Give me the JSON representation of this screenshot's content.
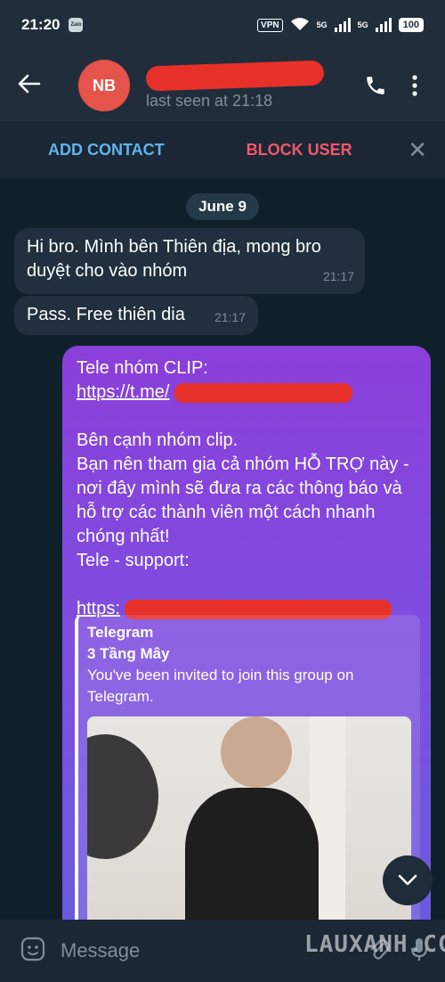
{
  "status": {
    "time": "21:20",
    "zalo": "Zalo",
    "vpn": "VPN",
    "net1": "5G",
    "net2": "5G",
    "battery": "100"
  },
  "header": {
    "avatar_initials": "NB",
    "avatar_color": "#e5534b",
    "subtitle": "last seen at 21:18",
    "back_icon": "arrow-left-icon",
    "call_icon": "phone-icon",
    "menu_icon": "more-vertical-icon"
  },
  "actions": {
    "add_contact": "ADD CONTACT",
    "block_user": "BLOCK USER",
    "close": "✕"
  },
  "chat": {
    "date_label": "June 9",
    "messages_in": [
      {
        "text": "Hi bro. Mình bên Thiên địa, mong bro duyệt cho vào nhóm",
        "time": "21:17"
      },
      {
        "text": "Pass. Free thiên dia",
        "time": "21:17"
      }
    ],
    "message_out": {
      "line1": "Tele nhóm CLIP:",
      "link1": "https://t.me/",
      "para": "Bên cạnh nhóm clip.",
      "line2": "Bạn nên tham gia cả nhóm HỖ TRỢ này - nơi đây mình sẽ đưa ra các thông báo và hỗ trợ các thành viên một cách nhanh chóng nhất!",
      "line3": "Tele - support:",
      "link2": "https:",
      "preview": {
        "site": "Telegram",
        "title": "3 Tầng Mây",
        "description": "You've been invited to join this group on Telegram."
      }
    }
  },
  "composer": {
    "placeholder": "Message",
    "watermark": "LAUXANH.CC"
  }
}
